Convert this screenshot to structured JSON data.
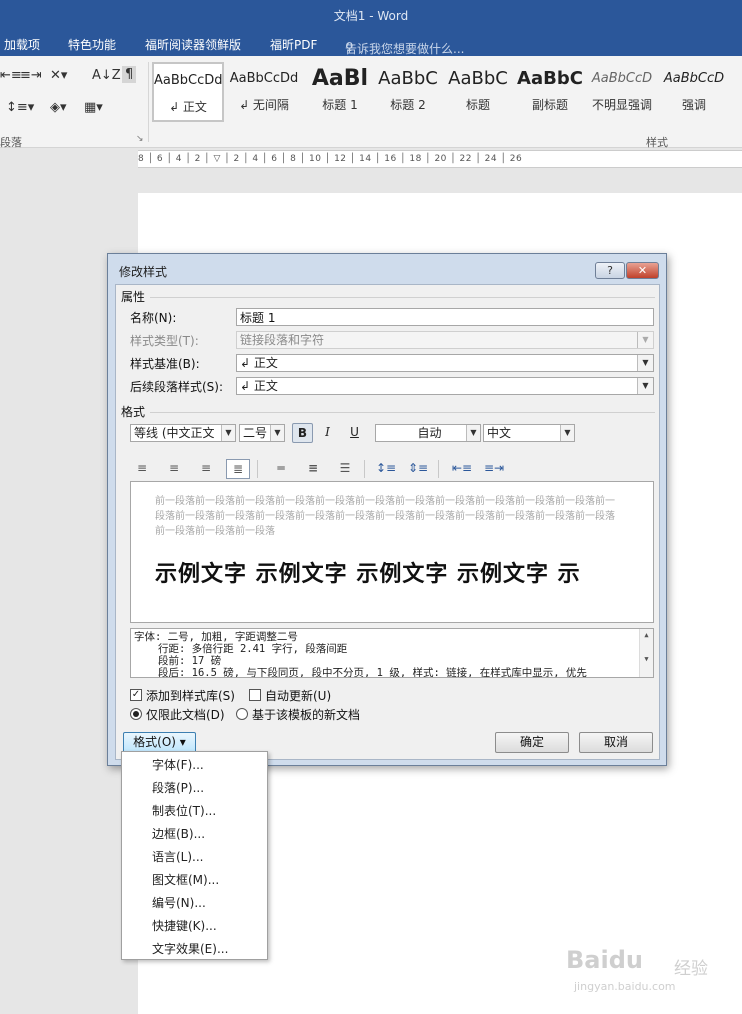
{
  "window": {
    "title": "文档1 - Word"
  },
  "menubar": {
    "items": [
      "加载项",
      "特色功能",
      "福昕阅读器领鲜版",
      "福昕PDF"
    ],
    "tell_me": "告诉我您想要做什么..."
  },
  "ribbon": {
    "paragraph_group_label": "段落",
    "styles_group_label": "样式",
    "styles": [
      {
        "sample": "AaBbCcDd",
        "name": "↲ 正文"
      },
      {
        "sample": "AaBbCcDd",
        "name": "↲ 无间隔"
      },
      {
        "sample": "AaBl",
        "name": "标题 1"
      },
      {
        "sample": "AaBbC",
        "name": "标题 2"
      },
      {
        "sample": "AaBbC",
        "name": "标题"
      },
      {
        "sample": "AaBbC",
        "name": "副标题"
      },
      {
        "sample": "AaBbCcD",
        "name": "不明显强调"
      },
      {
        "sample": "AaBbCcD",
        "name": "强调"
      }
    ],
    "ruler_text": "8 │ 6 │ 4 │ 2 │ ▽ │ 2 │ 4 │ 6 │ 8 │ 10 │ 12 │ 14 │ 16 │ 18 │ 20 │ 22 │ 24 │ 26"
  },
  "dialog": {
    "title": "修改样式",
    "help_label": "?",
    "close_label": "✕",
    "properties_heading": "属性",
    "name_label": "名称(N):",
    "name_value": "标题 1",
    "style_type_label": "样式类型(T):",
    "style_type_value": "链接段落和字符",
    "based_on_label": "样式基准(B):",
    "based_on_value": "↲ 正文",
    "following_label": "后续段落样式(S):",
    "following_value": "↲ 正文",
    "formatting_heading": "格式",
    "font_value": "等线 (中文正文",
    "size_value": "二号",
    "bold_label": "B",
    "italic_label": "I",
    "underline_label": "U",
    "color_value": "自动",
    "script_value": "中文",
    "preview_prev_text": "前一段落前一段落前一段落前一段落前一段落前一段落前一段落前一段落前一段落前一段落前一段落前一段落前一段落前一段落前一段落前一段落前一段落前一段落前一段落前一段落前一段落前一段落前一段落前一段落前一段落前一段落",
    "preview_sample_text": "示例文字 示例文字 示例文字 示例文字 示",
    "description_lines": [
      "字体: 二号, 加粗, 字距调整二号",
      "行距: 多倍行距 2.41 字行, 段落间距",
      "段前: 17 磅",
      "段后: 16.5 磅, 与下段同页, 段中不分页, 1 级, 样式: 链接, 在样式库中显示, 优先"
    ],
    "add_to_gallery_label": "添加到样式库(S)",
    "auto_update_label": "自动更新(U)",
    "only_this_doc_label": "仅限此文档(D)",
    "new_docs_label": "基于该模板的新文档",
    "format_button_label": "格式(O) ▾",
    "ok_label": "确定",
    "cancel_label": "取消"
  },
  "format_menu": {
    "items": [
      "字体(F)...",
      "段落(P)...",
      "制表位(T)...",
      "边框(B)...",
      "语言(L)...",
      "图文框(M)...",
      "编号(N)...",
      "快捷键(K)...",
      "文字效果(E)..."
    ]
  },
  "watermark": {
    "logo": "Baidu",
    "name": "经验",
    "url": "jingyan.baidu.com"
  }
}
